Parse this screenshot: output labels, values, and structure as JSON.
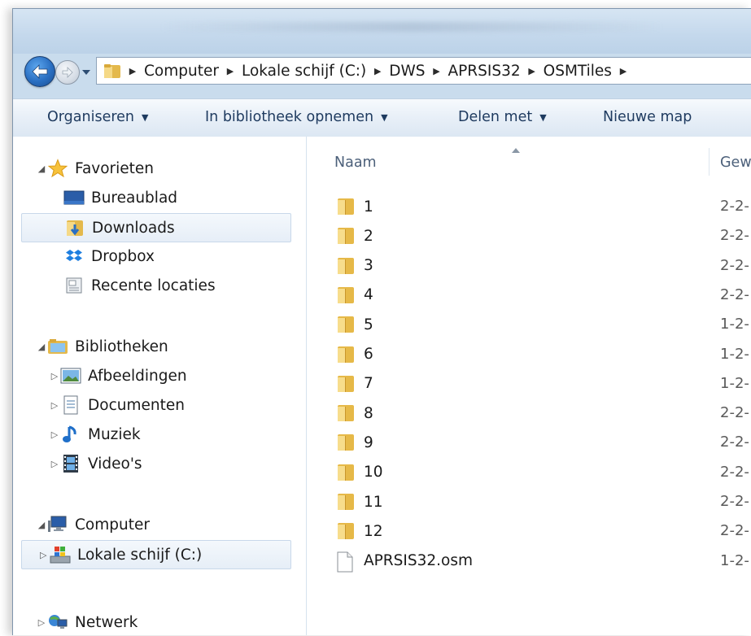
{
  "breadcrumb": [
    "Computer",
    "Lokale schijf (C:)",
    "DWS",
    "APRSIS32",
    "OSMTiles"
  ],
  "toolbar": {
    "organize": "Organiseren",
    "include_library": "In bibliotheek opnemen",
    "share_with": "Delen met",
    "new_folder": "Nieuwe map"
  },
  "nav": {
    "favorites": "Favorieten",
    "desktop": "Bureaublad",
    "downloads": "Downloads",
    "dropbox": "Dropbox",
    "recent": "Recente locaties",
    "libraries": "Bibliotheken",
    "pictures": "Afbeeldingen",
    "documents": "Documenten",
    "music": "Muziek",
    "videos": "Video's",
    "computer": "Computer",
    "local_disk": "Lokale schijf (C:)",
    "network": "Netwerk"
  },
  "columns": {
    "name": "Naam",
    "modified": "Gew"
  },
  "files": [
    {
      "name": "1",
      "date": "2-2-",
      "type": "folder"
    },
    {
      "name": "2",
      "date": "2-2-",
      "type": "folder"
    },
    {
      "name": "3",
      "date": "2-2-",
      "type": "folder"
    },
    {
      "name": "4",
      "date": "2-2-",
      "type": "folder"
    },
    {
      "name": "5",
      "date": "1-2-",
      "type": "folder"
    },
    {
      "name": "6",
      "date": "1-2-",
      "type": "folder"
    },
    {
      "name": "7",
      "date": "1-2-",
      "type": "folder"
    },
    {
      "name": "8",
      "date": "2-2-",
      "type": "folder"
    },
    {
      "name": "9",
      "date": "2-2-",
      "type": "folder"
    },
    {
      "name": "10",
      "date": "2-2-",
      "type": "folder"
    },
    {
      "name": "11",
      "date": "2-2-",
      "type": "folder"
    },
    {
      "name": "12",
      "date": "2-2-",
      "type": "folder"
    },
    {
      "name": "APRSIS32.osm",
      "date": "1-2-",
      "type": "file"
    }
  ],
  "colors": {
    "folder": "#e8c15a",
    "accent": "#2a6fc2",
    "selection": "#e6eef7"
  }
}
